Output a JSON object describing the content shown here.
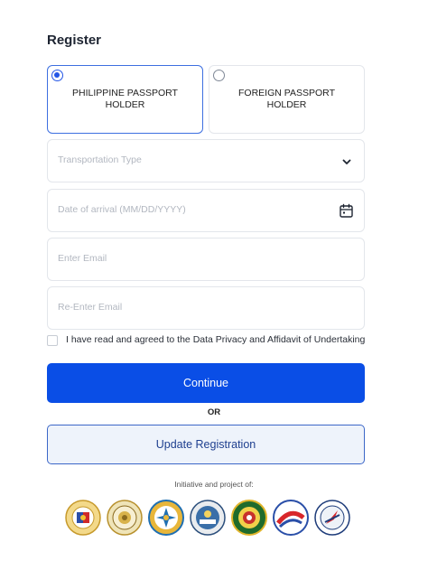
{
  "form": {
    "title": "Register",
    "passport_options": [
      {
        "label": "PHILIPPINE PASSPORT\nHOLDER",
        "selected": true
      },
      {
        "label": "FOREIGN PASSPORT\nHOLDER",
        "selected": false
      }
    ],
    "transportation_type": {
      "placeholder": "Transportation Type",
      "icon": "chevron-down-icon"
    },
    "date_of_arrival": {
      "placeholder": "Date of arrival (MM/DD/YYYY)",
      "icon": "calendar-icon"
    },
    "email": {
      "placeholder": "Enter Email"
    },
    "reenter_email": {
      "placeholder": "Re-Enter Email"
    },
    "agreement": {
      "label": "I have read and agreed to the Data Privacy and Affidavit of Undertaking",
      "checked": false
    },
    "continue_label": "Continue",
    "or_label": "OR",
    "update_label": "Update Registration"
  },
  "footer": {
    "initiative_text": "Initiative and project of:",
    "seals": [
      "seal-icon-1",
      "seal-icon-2",
      "seal-icon-3",
      "seal-icon-4",
      "seal-icon-5",
      "seal-icon-6",
      "seal-icon-7"
    ]
  },
  "colors": {
    "primary": "#0a4ee6",
    "radio_selected": "#2355e6",
    "update_border": "#3c67c8",
    "update_bg": "#eef3fb"
  }
}
